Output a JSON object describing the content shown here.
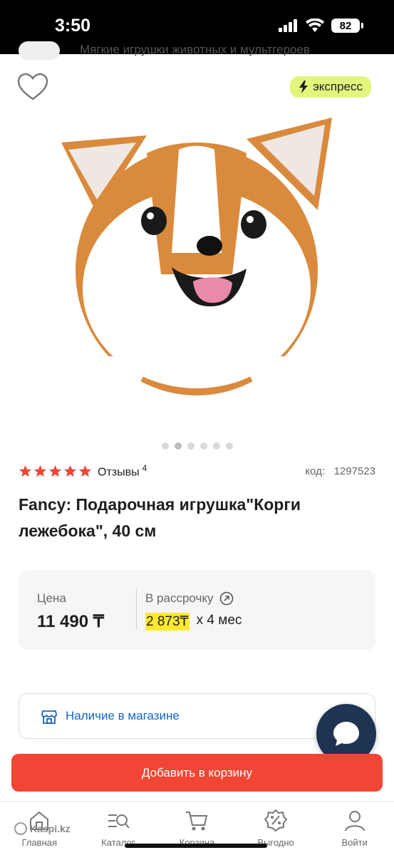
{
  "status_bar": {
    "time": "3:50",
    "battery": "82"
  },
  "breadcrumb": "Мягкие игрушки животных и мультгероев",
  "badge": {
    "express": "экспресс"
  },
  "gallery": {
    "dots": 6,
    "active": 1
  },
  "rating": {
    "stars": 5,
    "reviews_label": "Отзывы",
    "reviews_count": "4"
  },
  "product": {
    "code_label": "код:",
    "code": "1297523",
    "title": "Fancy: Подарочная игрушка\"Корги лежебока\", 40 см"
  },
  "price": {
    "label": "Цена",
    "value": "11 490 ₸",
    "installment_label": "В рассрочку",
    "installment_amount": "2 873₸",
    "installment_term": "х 4 мес"
  },
  "store": {
    "label": "Наличие в магазине"
  },
  "cart_button": "Добавить в корзину",
  "nav": [
    {
      "label": "Главная",
      "icon": "home-icon"
    },
    {
      "label": "Каталог",
      "icon": "catalog-icon"
    },
    {
      "label": "Корзина",
      "icon": "cart-icon"
    },
    {
      "label": "Выгодно",
      "icon": "discount-icon"
    },
    {
      "label": "Войти",
      "icon": "user-icon"
    }
  ],
  "watermark": "Kaspi.kz",
  "colors": {
    "accent": "#f14635",
    "link": "#1565c0",
    "express": "#e4f57d",
    "highlight": "#ffe930",
    "chat": "#1f3352"
  }
}
